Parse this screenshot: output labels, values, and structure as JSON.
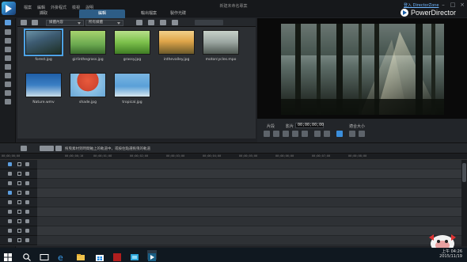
{
  "window": {
    "doc_title": "新建未命名專案",
    "brand": "PowerDirector",
    "top_link": "登入 DirectorZone",
    "menu": [
      "檔案",
      "編輯",
      "外掛程式",
      "檢視",
      "說明"
    ],
    "controls": [
      "minimize-icon",
      "maximize-icon",
      "close-icon"
    ]
  },
  "modes": {
    "tabs": [
      {
        "label": "擷取",
        "active": false
      },
      {
        "label": "編輯",
        "active": true
      },
      {
        "label": "輸出檔案",
        "active": false
      },
      {
        "label": "製作光碟",
        "active": false
      }
    ]
  },
  "library": {
    "dropdown_1": "媒體內容",
    "dropdown_2": "所有媒體",
    "items": [
      {
        "label": "forest.jpg",
        "selected": true,
        "color": "#3d5b72"
      },
      {
        "label": "girlinthegrass.jpg",
        "selected": false,
        "color": "#6aa84f"
      },
      {
        "label": "grassy.jpg",
        "selected": false,
        "color": "#7cc04b"
      },
      {
        "label": "inthevalley.jpg",
        "selected": false,
        "color": "#e0a64a"
      },
      {
        "label": "motorcycles.mpo",
        "selected": false,
        "color": "#9aa5a0"
      },
      {
        "label": "Nature.wmv",
        "selected": false,
        "color": "#3b7fc4"
      },
      {
        "label": "shade.jpg",
        "selected": false,
        "color": "#d14630"
      },
      {
        "label": "tropical.jpg",
        "selected": false,
        "color": "#5aa0d8"
      }
    ]
  },
  "preview": {
    "label_clip": "片段",
    "label_movie": "影片",
    "timecode": "00;00;00;00",
    "zoom": "適合大小"
  },
  "timeline": {
    "hint": "拖曳素材到時間軸上的軌道中，或按住點選拖曳的軌道",
    "ruler_ticks": [
      "00;00;00;00",
      "00;00;00;10",
      "00;00;01;08",
      "00;00;02;00",
      "00;00;03;00",
      "00;00;04;00",
      "00;00;05;00",
      "00;00;06;00",
      "00;00;07;00",
      "00;00;08;00"
    ],
    "tracks": [
      {
        "icon": "video-track-icon",
        "num": "1"
      },
      {
        "icon": "fx-track-icon",
        "num": "1"
      },
      {
        "icon": "video-track-icon",
        "num": "2"
      },
      {
        "icon": "audio-track-icon",
        "num": "2"
      },
      {
        "icon": "fx-track-icon",
        "num": "1"
      },
      {
        "icon": "voice-track-icon",
        "num": ""
      },
      {
        "icon": "title-track-icon",
        "num": ""
      },
      {
        "icon": "music-track-icon",
        "num": ""
      }
    ]
  },
  "taskbar": {
    "time": "上午 04:26",
    "date": "2015/11/19"
  }
}
